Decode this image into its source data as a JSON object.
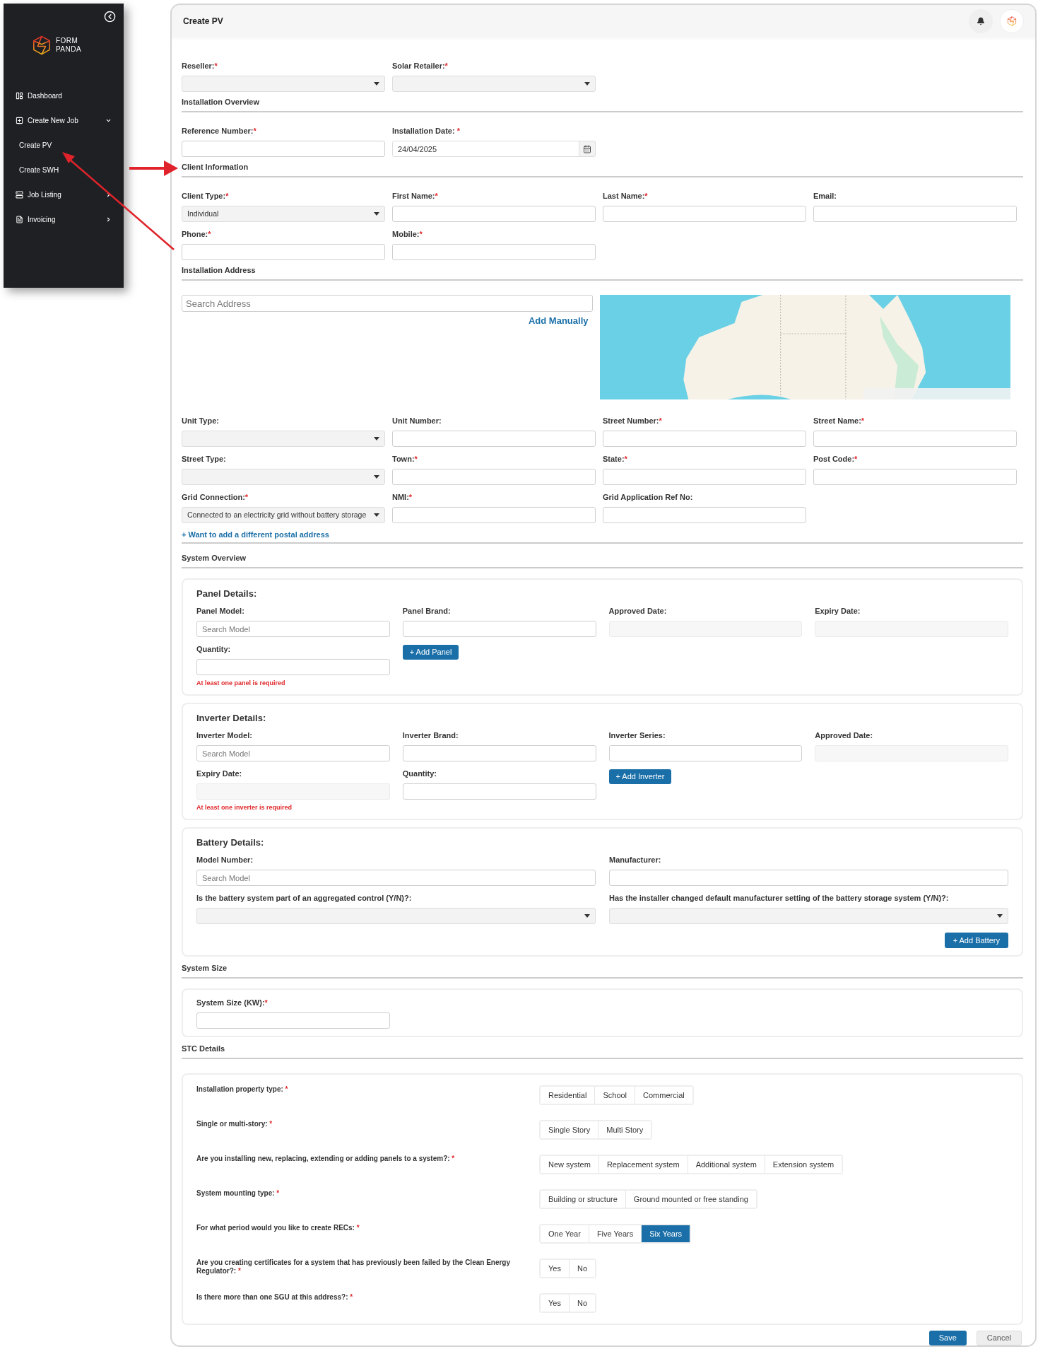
{
  "sidebar": {
    "logo": {
      "line1": "FORM",
      "line2": "PANDA"
    },
    "items": [
      {
        "label": "Dashboard",
        "kind": "link"
      },
      {
        "label": "Create New Job",
        "kind": "group",
        "expanded": true,
        "children": [
          {
            "label": "Create PV"
          },
          {
            "label": "Create SWH"
          }
        ]
      },
      {
        "label": "Job Listing",
        "kind": "group",
        "expanded": false
      },
      {
        "label": "Invoicing",
        "kind": "group",
        "expanded": false
      }
    ]
  },
  "header": {
    "title": "Create PV"
  },
  "sections": [
    {
      "rows": [
        [
          {
            "kind": "select",
            "label": "Reseller:",
            "required_mark": "*",
            "disabled": false
          },
          {
            "kind": "select",
            "label": "Solar Retailer:",
            "required_mark": "*",
            "disabled": false
          }
        ]
      ]
    },
    {
      "heading": "Installation Overview",
      "rows": [
        [
          {
            "kind": "text",
            "label": "Reference Number:",
            "required_mark": "*",
            "disabled": false
          },
          {
            "kind": "date",
            "label": "Installation Date:",
            "required_mark": " *",
            "value": "24/04/2025",
            "disabled": false
          }
        ]
      ]
    },
    {
      "heading": "Client Information",
      "rows": [
        [
          {
            "kind": "select",
            "label": "Client Type:",
            "required_mark": "*",
            "value": "Individual",
            "disabled": false
          },
          {
            "kind": "text",
            "label": "First Name:",
            "required_mark": "*",
            "disabled": false
          },
          {
            "kind": "text",
            "label": "Last Name:",
            "required_mark": "*",
            "disabled": false
          },
          {
            "kind": "text",
            "label": "Email:",
            "disabled": false
          }
        ],
        [
          {
            "kind": "text",
            "label": "Phone:",
            "required_mark": "*",
            "disabled": false
          },
          {
            "kind": "text",
            "label": "Mobile:",
            "required_mark": "*",
            "disabled": false
          }
        ]
      ]
    },
    {
      "heading": "Installation Address",
      "address_search": {
        "placeholder": "Search Address",
        "link": "Add Manually"
      },
      "rows": [
        [
          {
            "kind": "select",
            "label": "Unit Type:",
            "disabled": false
          },
          {
            "kind": "text",
            "label": "Unit Number:",
            "disabled": false
          },
          {
            "kind": "text",
            "label": "Street Number:",
            "required_mark": "*",
            "disabled": false
          },
          {
            "kind": "text",
            "label": "Street Name:",
            "required_mark": "*",
            "disabled": false
          }
        ],
        [
          {
            "kind": "select",
            "label": "Street Type:",
            "disabled": false
          },
          {
            "kind": "text",
            "label": "Town:",
            "required_mark": "*",
            "disabled": false
          },
          {
            "kind": "text",
            "label": "State:",
            "required_mark": "*",
            "disabled": false
          },
          {
            "kind": "text",
            "label": "Post Code:",
            "required_mark": "*",
            "disabled": false
          }
        ],
        [
          {
            "kind": "select",
            "label": "Grid Connection:",
            "required_mark": "*",
            "value": "Connected to an electricity grid without battery storage",
            "disabled": false
          },
          {
            "kind": "text",
            "label": "NMI:",
            "required_mark": "*",
            "disabled": false
          },
          {
            "kind": "text",
            "label": "Grid Application Ref No:",
            "disabled": false
          }
        ]
      ],
      "postal_link": "+ Want to add a different postal address"
    },
    {
      "heading": "System Overview",
      "cards": [
        {
          "title": "Panel Details:",
          "kind": "quad",
          "rows": [
            [
              {
                "kind": "text",
                "label": "Panel Model:",
                "placeholder": "Search Model",
                "disabled": false
              },
              {
                "kind": "text",
                "label": "Panel Brand:",
                "disabled": false
              },
              {
                "kind": "text",
                "label": "Approved Date:",
                "disabled": true
              },
              {
                "kind": "text",
                "label": "Expiry Date:",
                "disabled": true
              }
            ],
            [
              {
                "kind": "text",
                "label": "Quantity:",
                "disabled": false,
                "error": "At least one panel is required"
              },
              {
                "kind": "button",
                "label": "+ Add Panel"
              }
            ]
          ]
        },
        {
          "title": "Inverter Details:",
          "kind": "quad",
          "rows": [
            [
              {
                "kind": "text",
                "label": "Inverter Model:",
                "placeholder": "Search Model",
                "disabled": false
              },
              {
                "kind": "text",
                "label": "Inverter Brand:",
                "disabled": false
              },
              {
                "kind": "text",
                "label": "Inverter Series:",
                "disabled": false
              },
              {
                "kind": "text",
                "label": "Approved Date:",
                "disabled": true
              }
            ],
            [
              {
                "kind": "text",
                "label": "Expiry Date:",
                "disabled": true,
                "error": "At least one inverter is required"
              },
              {
                "kind": "text",
                "label": "Quantity:",
                "disabled": false
              },
              {
                "kind": "button",
                "label": "+ Add Inverter"
              }
            ]
          ]
        },
        {
          "title": "Battery Details:",
          "kind": "pair",
          "rows": [
            [
              {
                "kind": "text",
                "label": "Model Number:",
                "placeholder": "Search Model",
                "disabled": false
              },
              {
                "kind": "text",
                "label": "Manufacturer:",
                "disabled": false
              }
            ],
            [
              {
                "kind": "select",
                "label": "Is the battery system part of an aggregated control (Y/N)?:",
                "disabled": false
              },
              {
                "kind": "select",
                "label": "Has the installer changed default manufacturer setting of the battery storage system (Y/N)?:",
                "disabled": false
              }
            ]
          ],
          "action": "+ Add Battery"
        }
      ]
    },
    {
      "heading": "System Size",
      "cards": [
        {
          "kind": "quad",
          "rows": [
            [
              {
                "kind": "text",
                "label": "System Size (KW):",
                "required_mark": "*",
                "disabled": false
              }
            ]
          ]
        }
      ]
    },
    {
      "heading": "STC Details",
      "questions": [
        {
          "label": "Installation property type:",
          "required_mark": " *",
          "options": [
            {
              "label": "Residential",
              "selected": false
            },
            {
              "label": "School",
              "selected": false
            },
            {
              "label": "Commercial",
              "selected": false
            }
          ]
        },
        {
          "label": "Single or multi-story:",
          "required_mark": " *",
          "options": [
            {
              "label": "Single Story",
              "selected": false
            },
            {
              "label": "Multi Story",
              "selected": false
            }
          ]
        },
        {
          "label": "Are you installing new, replacing, extending or adding panels to a system?:",
          "required_mark": " *",
          "options": [
            {
              "label": "New system",
              "selected": false
            },
            {
              "label": "Replacement system",
              "selected": false
            },
            {
              "label": "Additional system",
              "selected": false
            },
            {
              "label": "Extension system",
              "selected": false
            }
          ]
        },
        {
          "label": "System mounting type:",
          "required_mark": " *",
          "options": [
            {
              "label": "Building or structure",
              "selected": false
            },
            {
              "label": "Ground mounted or free standing",
              "selected": false
            }
          ]
        },
        {
          "label": "For what period would you like to create RECs:",
          "required_mark": " *",
          "options": [
            {
              "label": "One Year",
              "selected": false
            },
            {
              "label": "Five Years",
              "selected": false
            },
            {
              "label": "Six Years",
              "selected": true
            }
          ]
        },
        {
          "label": "Are you creating certificates for a system that has previously been failed by the Clean Energy Regulator?:",
          "required_mark": " *",
          "options": [
            {
              "label": "Yes",
              "selected": false
            },
            {
              "label": "No",
              "selected": false
            }
          ]
        },
        {
          "label": "Is there more than one SGU at this address?:",
          "required_mark": " *",
          "options": [
            {
              "label": "Yes",
              "selected": false
            },
            {
              "label": "No",
              "selected": false
            }
          ]
        }
      ]
    }
  ],
  "footer": {
    "buttons": [
      {
        "label": "Save",
        "kind": "primary"
      },
      {
        "label": "Cancel",
        "kind": "secondary"
      }
    ]
  }
}
